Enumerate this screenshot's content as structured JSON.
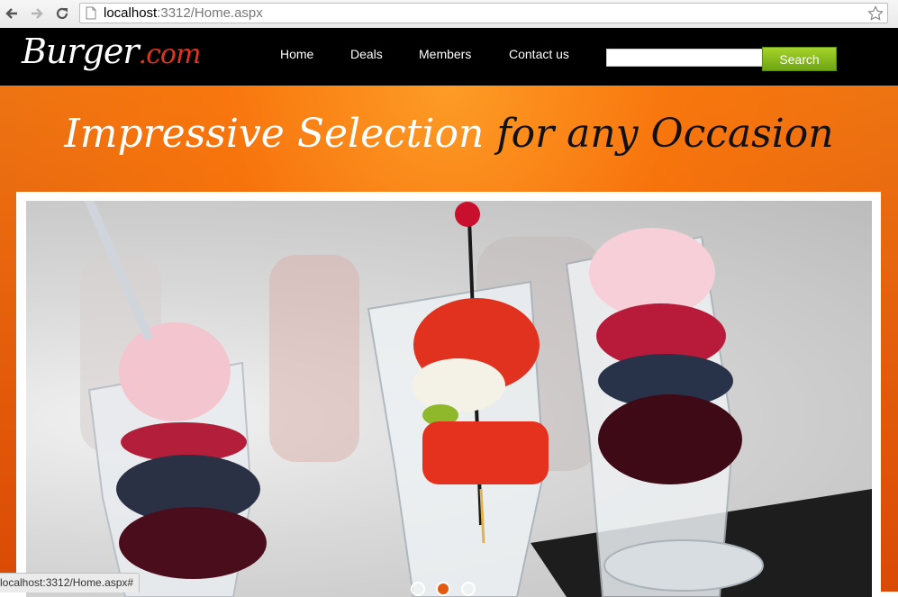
{
  "browser": {
    "url_host": "localhost",
    "url_rest": ":3312/Home.aspx",
    "status_url": "localhost:3312/Home.aspx#"
  },
  "site": {
    "logo_main": "Burger",
    "logo_accent": ".com",
    "menu": [
      "Home",
      "Deals",
      "Members",
      "Contact us"
    ],
    "search_placeholder": "",
    "search_button": "Search"
  },
  "banner": {
    "tagline_light": "Impressive Selection",
    "tagline_dark": "for any Occasion"
  },
  "slider": {
    "dots": 3,
    "active_dot": 1
  },
  "colors": {
    "header_bg": "#000000",
    "banner_orange": "#e8640c",
    "search_green": "#8cc21f",
    "logo_accent": "#e3331a"
  },
  "icons": [
    "back-icon",
    "forward-icon",
    "reload-icon",
    "page-icon",
    "bookmark-star-icon"
  ]
}
